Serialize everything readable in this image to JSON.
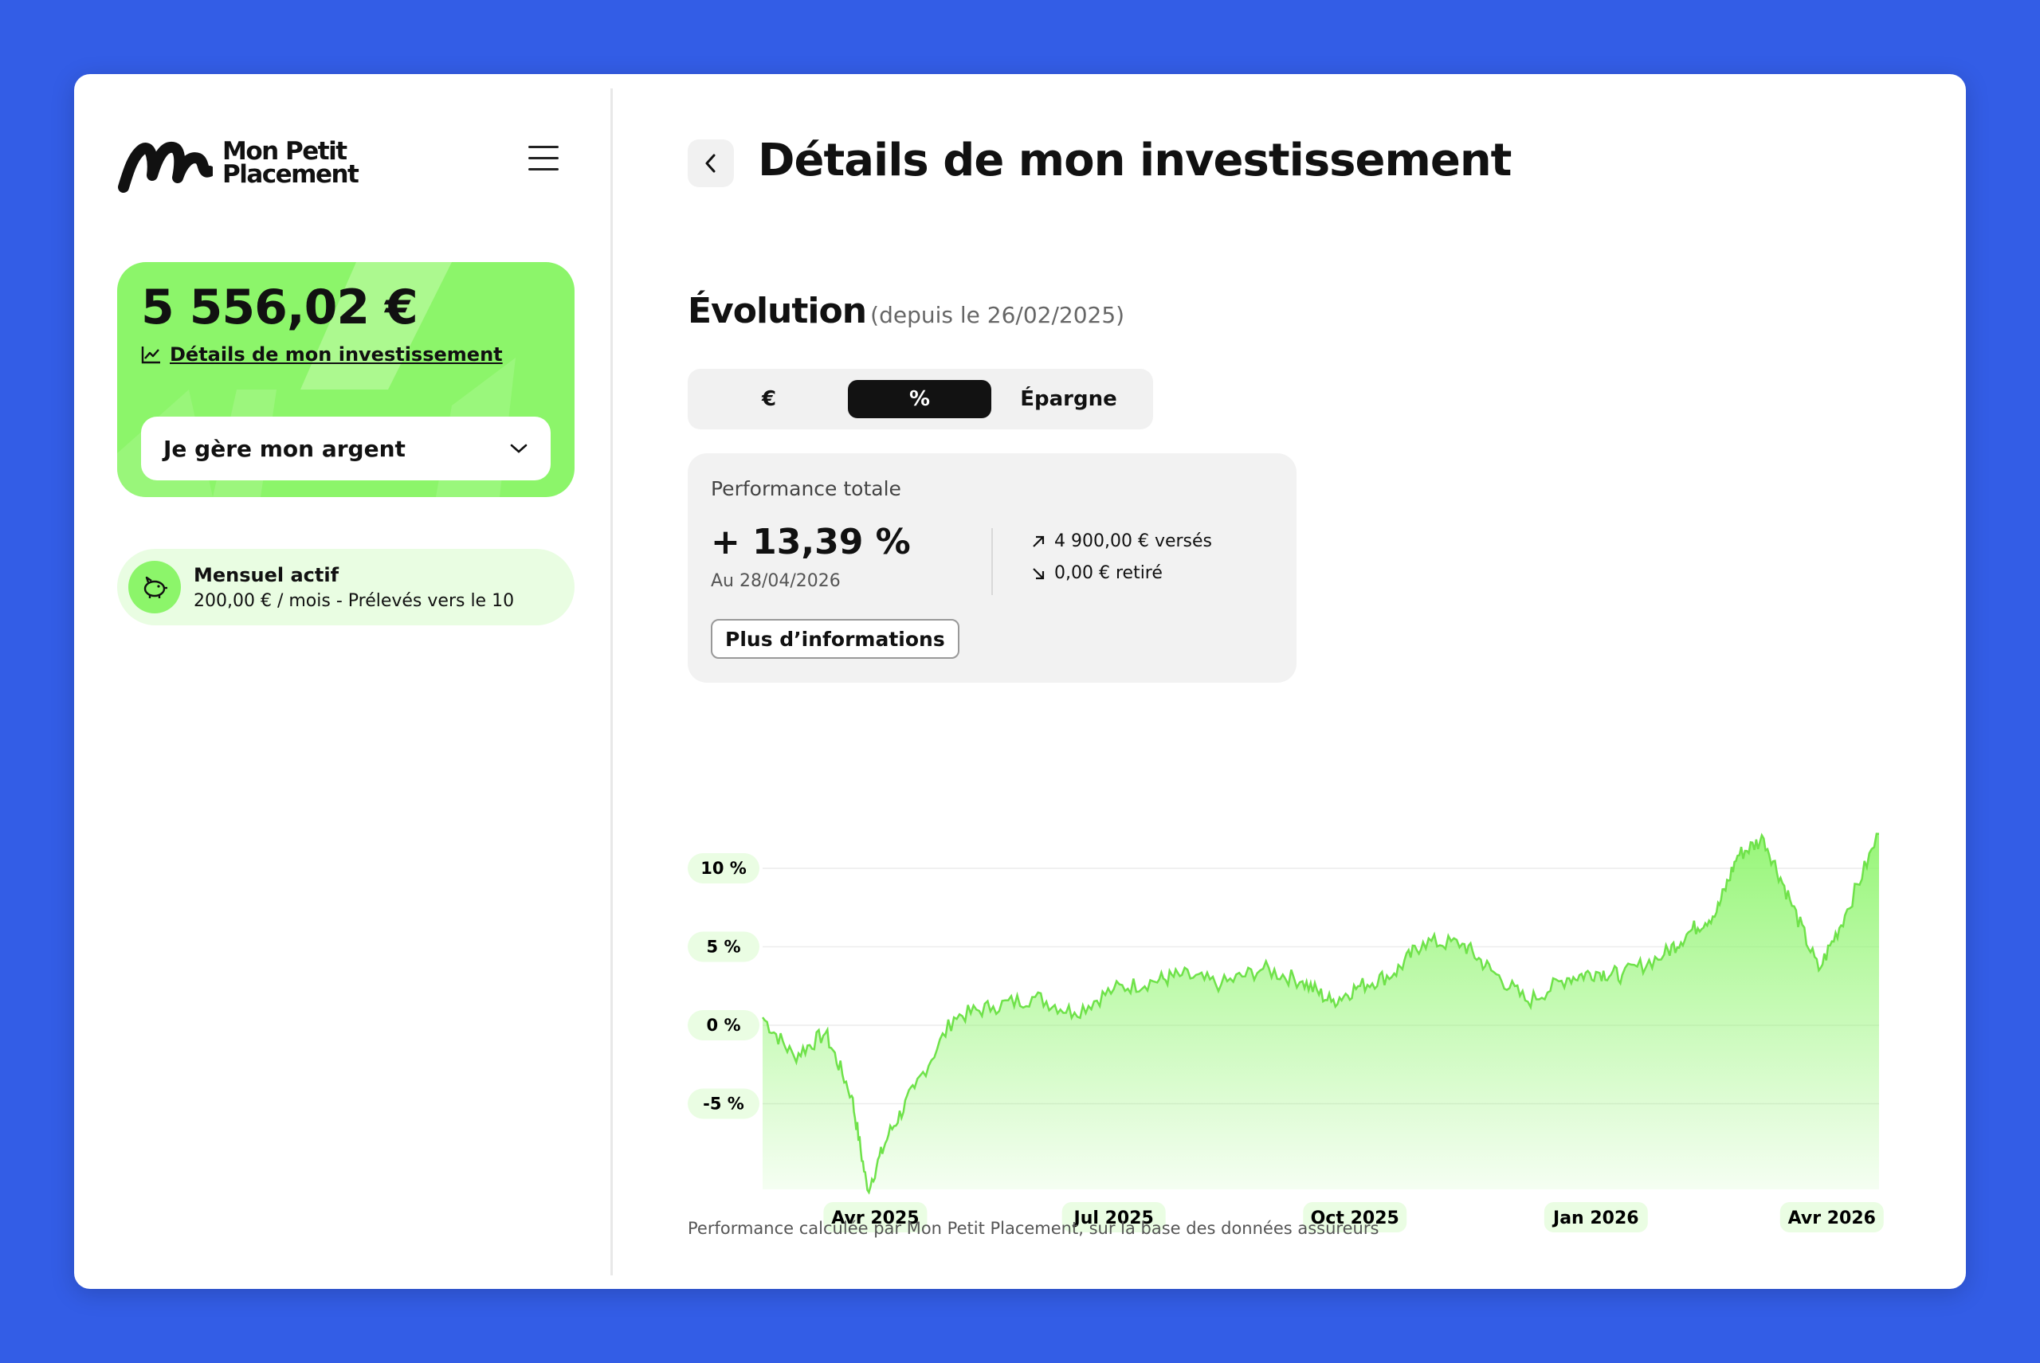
{
  "app": {
    "logo_line1": "Mon Petit",
    "logo_line2": "Placement"
  },
  "sidebar": {
    "balance": "5 556,02 €",
    "details_link": "Détails de mon investissement",
    "dropdown_label": "Je gère mon argent",
    "monthly": {
      "title": "Mensuel actif",
      "subtitle": "200,00 € / mois - Prélevés vers le 10"
    }
  },
  "header": {
    "title": "Détails de mon investissement"
  },
  "evolution": {
    "title": "Évolution",
    "since": "(depuis le 26/02/2025)",
    "toggle": {
      "euro": "€",
      "percent": "%",
      "epargne": "Épargne",
      "selected": "percent"
    }
  },
  "performance": {
    "label": "Performance totale",
    "value": "+ 13,39 %",
    "date": "Au 28/04/2026",
    "deposited": "4 900,00 € versés",
    "withdrawn": "0,00 € retiré",
    "more_button": "Plus d’informations"
  },
  "colors": {
    "accent_green": "#8cf56a",
    "background_blue": "#335de6",
    "dark": "#121212"
  },
  "chart_data": {
    "type": "area",
    "y_ticks": [
      "10 %",
      "5 %",
      "0 %",
      "-5 %"
    ],
    "x_ticks": [
      "Avr 2025",
      "Jul 2025",
      "Oct 2025",
      "Jan 2026",
      "Avr 2026"
    ],
    "ylim": [
      -11,
      13
    ],
    "ylabel": "",
    "xlabel": "",
    "x": [
      "2025-02-26",
      "2025-03-10",
      "2025-03-22",
      "2025-04-01",
      "2025-04-07",
      "2025-04-15",
      "2025-04-25",
      "2025-05-10",
      "2025-05-25",
      "2025-06-10",
      "2025-06-25",
      "2025-07-10",
      "2025-07-25",
      "2025-08-05",
      "2025-08-20",
      "2025-09-05",
      "2025-09-20",
      "2025-10-01",
      "2025-10-12",
      "2025-10-25",
      "2025-11-05",
      "2025-11-20",
      "2025-12-01",
      "2025-12-15",
      "2025-12-30",
      "2026-01-10",
      "2026-01-20",
      "2026-02-05",
      "2026-02-15",
      "2026-02-25",
      "2026-03-05",
      "2026-03-15",
      "2026-03-25",
      "2026-04-05",
      "2026-04-15",
      "2026-04-28"
    ],
    "values": [
      0.5,
      -2.0,
      -0.5,
      -4.5,
      -10.5,
      -7.0,
      -4.0,
      0.5,
      1.2,
      1.8,
      0.8,
      2.3,
      2.8,
      3.2,
      2.6,
      3.6,
      2.8,
      1.5,
      2.5,
      3.3,
      5.3,
      5.2,
      3.5,
      1.5,
      3.0,
      3.4,
      3.2,
      4.5,
      6.0,
      7.2,
      10.8,
      11.9,
      8.0,
      3.5,
      7.0,
      12.2
    ],
    "series": [
      {
        "values_key": "values"
      }
    ]
  },
  "footnote": "Performance calculée par Mon Petit Placement, sur la base des données assureurs"
}
